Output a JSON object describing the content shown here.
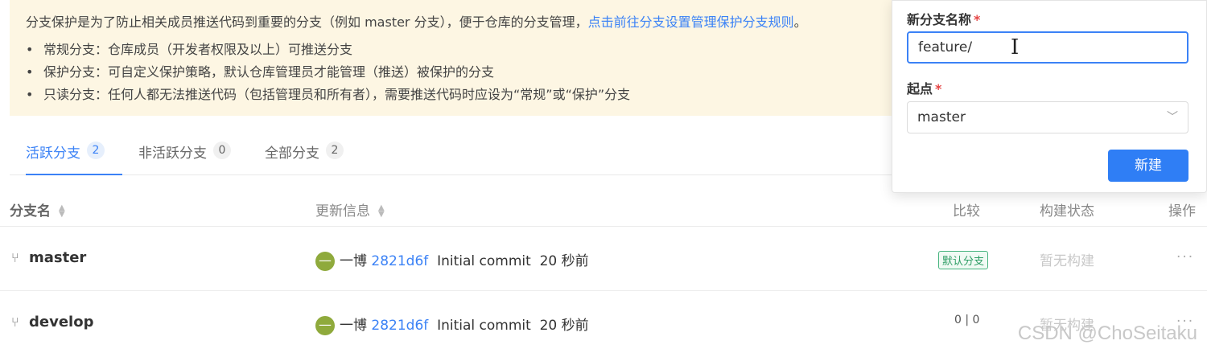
{
  "notice": {
    "intro": "分支保护是为了防止相关成员推送代码到重要的分支（例如 master 分支），便于仓库的分支管理，",
    "link": "点击前往分支设置管理保护分支规则",
    "tail": "。",
    "bullets": [
      "常规分支：仓库成员（开发者权限及以上）可推送分支",
      "保护分支：可自定义保护策略，默认仓库管理员才能管理（推送）被保护的分支",
      "只读分支：任何人都无法推送代码（包括管理员和所有者），需要推送代码时应设为“常规”或“保护”分支"
    ]
  },
  "tabs": [
    {
      "label": "活跃分支",
      "count": "2"
    },
    {
      "label": "非活跃分支",
      "count": "0"
    },
    {
      "label": "全部分支",
      "count": "2"
    }
  ],
  "table": {
    "headers": {
      "name": "分支名",
      "update": "更新信息",
      "compare": "比较",
      "build": "构建状态",
      "ops": "操作"
    },
    "rows": [
      {
        "name": "master",
        "author": "一博",
        "hash": "2821d6f",
        "message": "Initial commit",
        "time": "20 秒前",
        "compare": "",
        "badge": "默认分支",
        "build": "暂无构建",
        "ops": "···"
      },
      {
        "name": "develop",
        "author": "一博",
        "hash": "2821d6f",
        "message": "Initial commit",
        "time": "20 秒前",
        "compare": "0 | 0",
        "badge": "",
        "build": "暂无构建",
        "ops": "···"
      }
    ]
  },
  "popover": {
    "name_label": "新分支名称",
    "name_value": "feature/",
    "origin_label": "起点",
    "origin_value": "master",
    "submit": "新建"
  },
  "watermark": "CSDN @ChoSeitaku",
  "colors": {
    "accent": "#3b82f6",
    "notice_bg": "#fdf6e3",
    "badge": "#2f9e66"
  }
}
